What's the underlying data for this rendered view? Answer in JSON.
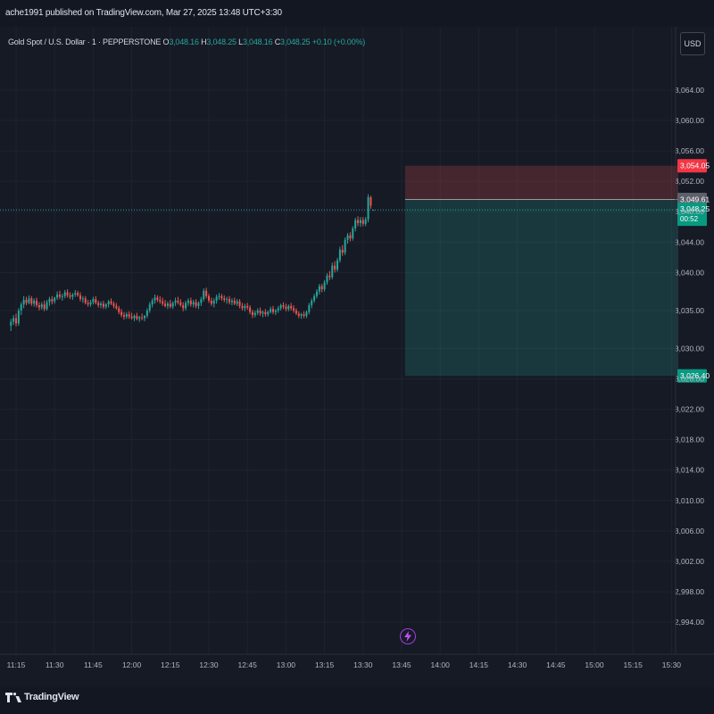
{
  "header": {
    "publisher_line": "ache1991 published on TradingView.com, Mar 27, 2025 13:48 UTC+3:30"
  },
  "legend": {
    "symbol": "Gold Spot / U.S. Dollar · 1 · PEPPERSTONE",
    "o_label": "O",
    "o_value": "3,048.16",
    "h_label": "H",
    "h_value": "3,048.25",
    "l_label": "L",
    "l_value": "3,048.16",
    "c_label": "C",
    "c_value": "3,048.25",
    "change": "+0.10 (+0.00%)"
  },
  "currency_button": "USD",
  "footer": {
    "logo_text": "TradingView",
    "logo_icon": "tradingview-logo-icon"
  },
  "flash_icon": "lightning-icon",
  "colors": {
    "up": "#26a69a",
    "down": "#ef5350",
    "stop_zone": "#ef5350",
    "target_zone": "#26a69a",
    "background": "#161a25"
  },
  "chart_data": {
    "type": "candlestick",
    "symbol": "Gold Spot / U.S. Dollar",
    "interval": "1",
    "y_ticks": [
      "3,064.00",
      "3,060.00",
      "3,056.00",
      "3,052.00",
      "3,048.00",
      "3,044.00",
      "3,040.00",
      "3,035.00",
      "3,030.00",
      "3,026.00",
      "3,022.00",
      "3,018.00",
      "3,014.00",
      "3,010.00",
      "3,006.00",
      "3,002.00",
      "2,998.00",
      "2,994.00"
    ],
    "y_tick_values": [
      3064,
      3060,
      3056,
      3052,
      3048,
      3044,
      3040,
      3035,
      3030,
      3026,
      3022,
      3018,
      3014,
      3010,
      3006,
      3002,
      2998,
      2994
    ],
    "x_ticks": [
      "11:15",
      "11:30",
      "11:45",
      "12:00",
      "12:15",
      "12:30",
      "12:45",
      "13:00",
      "13:15",
      "13:30",
      "13:45",
      "14:00",
      "14:15",
      "14:30",
      "14:45",
      "15:00",
      "15:15",
      "15:30"
    ],
    "price_labels": [
      {
        "text": "3,054.05",
        "value": 3054.05,
        "kind": "stop"
      },
      {
        "text": "3,049.61",
        "value": 3049.61,
        "kind": "entry"
      },
      {
        "text": "3,048.25",
        "sub": "00:52",
        "value": 3048.25,
        "kind": "last"
      },
      {
        "text": "3,026.40",
        "value": 3026.4,
        "kind": "target"
      }
    ],
    "position": {
      "entry": 3049.61,
      "stop": 3054.05,
      "target": 3026.4,
      "start_time": "13:46"
    },
    "last_price": 3048.25,
    "candles": [
      {
        "t": "11:13",
        "o": 3033.0,
        "h": 3033.9,
        "l": 3032.3,
        "c": 3033.5
      },
      {
        "t": "11:14",
        "o": 3033.5,
        "h": 3034.4,
        "l": 3033.1,
        "c": 3034.0
      },
      {
        "t": "11:15",
        "o": 3034.0,
        "h": 3034.6,
        "l": 3032.9,
        "c": 3033.3
      },
      {
        "t": "11:16",
        "o": 3033.3,
        "h": 3035.3,
        "l": 3033.0,
        "c": 3035.0
      },
      {
        "t": "11:17",
        "o": 3035.0,
        "h": 3036.1,
        "l": 3034.4,
        "c": 3035.8
      },
      {
        "t": "11:18",
        "o": 3035.8,
        "h": 3036.9,
        "l": 3035.3,
        "c": 3036.4
      },
      {
        "t": "11:19",
        "o": 3036.4,
        "h": 3036.8,
        "l": 3035.7,
        "c": 3036.0
      },
      {
        "t": "11:20",
        "o": 3036.0,
        "h": 3037.0,
        "l": 3035.8,
        "c": 3036.6
      },
      {
        "t": "11:21",
        "o": 3036.6,
        "h": 3036.9,
        "l": 3035.6,
        "c": 3035.9
      },
      {
        "t": "11:22",
        "o": 3035.9,
        "h": 3036.6,
        "l": 3035.5,
        "c": 3036.3
      },
      {
        "t": "11:23",
        "o": 3036.3,
        "h": 3036.7,
        "l": 3035.4,
        "c": 3035.7
      },
      {
        "t": "11:24",
        "o": 3035.7,
        "h": 3036.1,
        "l": 3035.0,
        "c": 3035.4
      },
      {
        "t": "11:25",
        "o": 3035.4,
        "h": 3036.1,
        "l": 3035.1,
        "c": 3035.8
      },
      {
        "t": "11:26",
        "o": 3035.8,
        "h": 3036.3,
        "l": 3034.9,
        "c": 3035.2
      },
      {
        "t": "11:27",
        "o": 3035.2,
        "h": 3036.4,
        "l": 3035.0,
        "c": 3036.1
      },
      {
        "t": "11:28",
        "o": 3036.1,
        "h": 3036.8,
        "l": 3035.6,
        "c": 3036.5
      },
      {
        "t": "11:29",
        "o": 3036.5,
        "h": 3036.9,
        "l": 3035.8,
        "c": 3036.2
      },
      {
        "t": "11:30",
        "o": 3036.2,
        "h": 3036.8,
        "l": 3035.9,
        "c": 3036.7
      },
      {
        "t": "11:31",
        "o": 3036.7,
        "h": 3037.5,
        "l": 3036.4,
        "c": 3037.1
      },
      {
        "t": "11:32",
        "o": 3037.1,
        "h": 3037.6,
        "l": 3036.5,
        "c": 3036.8
      },
      {
        "t": "11:33",
        "o": 3036.8,
        "h": 3037.2,
        "l": 3036.3,
        "c": 3036.9
      },
      {
        "t": "11:34",
        "o": 3036.9,
        "h": 3037.7,
        "l": 3036.6,
        "c": 3037.4
      },
      {
        "t": "11:35",
        "o": 3037.4,
        "h": 3037.8,
        "l": 3036.7,
        "c": 3037.0
      },
      {
        "t": "11:36",
        "o": 3037.0,
        "h": 3037.4,
        "l": 3036.5,
        "c": 3036.8
      },
      {
        "t": "11:37",
        "o": 3036.8,
        "h": 3037.3,
        "l": 3036.4,
        "c": 3037.1
      },
      {
        "t": "11:38",
        "o": 3037.1,
        "h": 3037.7,
        "l": 3036.8,
        "c": 3037.3
      },
      {
        "t": "11:39",
        "o": 3037.3,
        "h": 3037.6,
        "l": 3036.8,
        "c": 3037.0
      },
      {
        "t": "11:40",
        "o": 3037.0,
        "h": 3037.4,
        "l": 3036.2,
        "c": 3036.5
      },
      {
        "t": "11:41",
        "o": 3036.5,
        "h": 3036.9,
        "l": 3036.0,
        "c": 3036.6
      },
      {
        "t": "11:42",
        "o": 3036.6,
        "h": 3036.9,
        "l": 3035.8,
        "c": 3036.0
      },
      {
        "t": "11:43",
        "o": 3036.0,
        "h": 3036.4,
        "l": 3035.5,
        "c": 3035.8
      },
      {
        "t": "11:44",
        "o": 3035.8,
        "h": 3036.4,
        "l": 3035.5,
        "c": 3036.1
      },
      {
        "t": "11:45",
        "o": 3036.1,
        "h": 3036.8,
        "l": 3035.8,
        "c": 3036.5
      },
      {
        "t": "11:46",
        "o": 3036.5,
        "h": 3036.9,
        "l": 3035.8,
        "c": 3036.0
      },
      {
        "t": "11:47",
        "o": 3036.0,
        "h": 3036.3,
        "l": 3035.4,
        "c": 3035.7
      },
      {
        "t": "11:48",
        "o": 3035.7,
        "h": 3036.2,
        "l": 3035.3,
        "c": 3035.9
      },
      {
        "t": "11:49",
        "o": 3035.9,
        "h": 3036.3,
        "l": 3035.2,
        "c": 3035.5
      },
      {
        "t": "11:50",
        "o": 3035.5,
        "h": 3036.0,
        "l": 3035.2,
        "c": 3035.8
      },
      {
        "t": "11:51",
        "o": 3035.8,
        "h": 3036.4,
        "l": 3035.4,
        "c": 3036.2
      },
      {
        "t": "11:52",
        "o": 3036.2,
        "h": 3036.6,
        "l": 3035.7,
        "c": 3035.9
      },
      {
        "t": "11:53",
        "o": 3035.9,
        "h": 3036.2,
        "l": 3035.3,
        "c": 3035.6
      },
      {
        "t": "11:54",
        "o": 3035.6,
        "h": 3036.0,
        "l": 3035.1,
        "c": 3035.3
      },
      {
        "t": "11:55",
        "o": 3035.3,
        "h": 3035.6,
        "l": 3034.5,
        "c": 3034.8
      },
      {
        "t": "11:56",
        "o": 3034.8,
        "h": 3035.2,
        "l": 3034.1,
        "c": 3034.4
      },
      {
        "t": "11:57",
        "o": 3034.4,
        "h": 3034.8,
        "l": 3033.8,
        "c": 3034.2
      },
      {
        "t": "11:58",
        "o": 3034.2,
        "h": 3034.8,
        "l": 3033.9,
        "c": 3034.5
      },
      {
        "t": "11:59",
        "o": 3034.5,
        "h": 3034.9,
        "l": 3033.9,
        "c": 3034.2
      },
      {
        "t": "12:00",
        "o": 3034.2,
        "h": 3034.7,
        "l": 3033.8,
        "c": 3034.0
      },
      {
        "t": "12:01",
        "o": 3034.0,
        "h": 3034.5,
        "l": 3033.6,
        "c": 3034.3
      },
      {
        "t": "12:02",
        "o": 3034.3,
        "h": 3034.7,
        "l": 3033.7,
        "c": 3033.9
      },
      {
        "t": "12:03",
        "o": 3033.9,
        "h": 3034.3,
        "l": 3033.5,
        "c": 3034.1
      },
      {
        "t": "12:04",
        "o": 3034.1,
        "h": 3034.6,
        "l": 3033.7,
        "c": 3034.0
      },
      {
        "t": "12:05",
        "o": 3034.0,
        "h": 3034.4,
        "l": 3033.6,
        "c": 3034.3
      },
      {
        "t": "12:06",
        "o": 3034.3,
        "h": 3035.3,
        "l": 3034.0,
        "c": 3035.0
      },
      {
        "t": "12:07",
        "o": 3035.0,
        "h": 3036.1,
        "l": 3034.7,
        "c": 3035.8
      },
      {
        "t": "12:08",
        "o": 3035.8,
        "h": 3036.6,
        "l": 3035.4,
        "c": 3036.3
      },
      {
        "t": "12:09",
        "o": 3036.3,
        "h": 3037.1,
        "l": 3035.9,
        "c": 3036.7
      },
      {
        "t": "12:10",
        "o": 3036.7,
        "h": 3037.0,
        "l": 3036.1,
        "c": 3036.4
      },
      {
        "t": "12:11",
        "o": 3036.4,
        "h": 3036.9,
        "l": 3035.9,
        "c": 3036.2
      },
      {
        "t": "12:12",
        "o": 3036.2,
        "h": 3036.7,
        "l": 3035.6,
        "c": 3035.9
      },
      {
        "t": "12:13",
        "o": 3035.9,
        "h": 3036.4,
        "l": 3035.4,
        "c": 3035.6
      },
      {
        "t": "12:14",
        "o": 3035.6,
        "h": 3036.2,
        "l": 3035.2,
        "c": 3035.9
      },
      {
        "t": "12:15",
        "o": 3035.9,
        "h": 3036.4,
        "l": 3035.3,
        "c": 3035.5
      },
      {
        "t": "12:16",
        "o": 3035.5,
        "h": 3036.2,
        "l": 3035.2,
        "c": 3036.0
      },
      {
        "t": "12:17",
        "o": 3036.0,
        "h": 3036.7,
        "l": 3035.6,
        "c": 3036.3
      },
      {
        "t": "12:18",
        "o": 3036.3,
        "h": 3036.8,
        "l": 3035.8,
        "c": 3036.1
      },
      {
        "t": "12:19",
        "o": 3036.1,
        "h": 3036.5,
        "l": 3035.5,
        "c": 3035.7
      },
      {
        "t": "12:20",
        "o": 3035.7,
        "h": 3036.1,
        "l": 3034.9,
        "c": 3035.3
      },
      {
        "t": "12:21",
        "o": 3035.3,
        "h": 3036.3,
        "l": 3035.0,
        "c": 3036.0
      },
      {
        "t": "12:22",
        "o": 3036.0,
        "h": 3036.6,
        "l": 3035.6,
        "c": 3036.3
      },
      {
        "t": "12:23",
        "o": 3036.3,
        "h": 3036.7,
        "l": 3035.5,
        "c": 3035.8
      },
      {
        "t": "12:24",
        "o": 3035.8,
        "h": 3036.4,
        "l": 3035.4,
        "c": 3036.1
      },
      {
        "t": "12:25",
        "o": 3036.1,
        "h": 3036.5,
        "l": 3035.3,
        "c": 3035.6
      },
      {
        "t": "12:26",
        "o": 3035.6,
        "h": 3036.2,
        "l": 3035.2,
        "c": 3036.0
      },
      {
        "t": "12:27",
        "o": 3036.0,
        "h": 3036.8,
        "l": 3035.6,
        "c": 3036.5
      },
      {
        "t": "12:28",
        "o": 3036.5,
        "h": 3037.9,
        "l": 3036.2,
        "c": 3037.6
      },
      {
        "t": "12:29",
        "o": 3037.6,
        "h": 3038.0,
        "l": 3036.6,
        "c": 3036.9
      },
      {
        "t": "12:30",
        "o": 3036.9,
        "h": 3037.2,
        "l": 3036.0,
        "c": 3036.3
      },
      {
        "t": "12:31",
        "o": 3036.3,
        "h": 3036.7,
        "l": 3035.6,
        "c": 3035.9
      },
      {
        "t": "12:32",
        "o": 3035.9,
        "h": 3036.6,
        "l": 3035.4,
        "c": 3036.3
      },
      {
        "t": "12:33",
        "o": 3036.3,
        "h": 3037.1,
        "l": 3035.9,
        "c": 3036.8
      },
      {
        "t": "12:34",
        "o": 3036.8,
        "h": 3037.3,
        "l": 3036.4,
        "c": 3036.9
      },
      {
        "t": "12:35",
        "o": 3036.9,
        "h": 3037.2,
        "l": 3036.3,
        "c": 3036.6
      },
      {
        "t": "12:36",
        "o": 3036.6,
        "h": 3037.0,
        "l": 3036.1,
        "c": 3036.4
      },
      {
        "t": "12:37",
        "o": 3036.4,
        "h": 3036.8,
        "l": 3035.9,
        "c": 3036.5
      },
      {
        "t": "12:38",
        "o": 3036.5,
        "h": 3036.9,
        "l": 3035.8,
        "c": 3036.1
      },
      {
        "t": "12:39",
        "o": 3036.1,
        "h": 3036.6,
        "l": 3035.7,
        "c": 3036.3
      },
      {
        "t": "12:40",
        "o": 3036.3,
        "h": 3036.7,
        "l": 3035.7,
        "c": 3035.9
      },
      {
        "t": "12:41",
        "o": 3035.9,
        "h": 3036.5,
        "l": 3035.6,
        "c": 3036.2
      },
      {
        "t": "12:42",
        "o": 3036.2,
        "h": 3036.5,
        "l": 3035.3,
        "c": 3035.6
      },
      {
        "t": "12:43",
        "o": 3035.6,
        "h": 3036.0,
        "l": 3035.0,
        "c": 3035.3
      },
      {
        "t": "12:44",
        "o": 3035.3,
        "h": 3035.9,
        "l": 3034.9,
        "c": 3035.6
      },
      {
        "t": "12:45",
        "o": 3035.6,
        "h": 3036.0,
        "l": 3035.1,
        "c": 3035.4
      },
      {
        "t": "12:46",
        "o": 3035.4,
        "h": 3035.7,
        "l": 3034.5,
        "c": 3034.8
      },
      {
        "t": "12:47",
        "o": 3034.8,
        "h": 3035.1,
        "l": 3034.0,
        "c": 3034.4
      },
      {
        "t": "12:48",
        "o": 3034.4,
        "h": 3035.0,
        "l": 3034.1,
        "c": 3034.7
      },
      {
        "t": "12:49",
        "o": 3034.7,
        "h": 3035.3,
        "l": 3034.4,
        "c": 3035.0
      },
      {
        "t": "12:50",
        "o": 3035.0,
        "h": 3035.4,
        "l": 3034.3,
        "c": 3034.6
      },
      {
        "t": "12:51",
        "o": 3034.6,
        "h": 3035.0,
        "l": 3034.1,
        "c": 3034.8
      },
      {
        "t": "12:52",
        "o": 3034.8,
        "h": 3035.2,
        "l": 3034.2,
        "c": 3034.5
      },
      {
        "t": "12:53",
        "o": 3034.5,
        "h": 3035.0,
        "l": 3034.2,
        "c": 3034.8
      },
      {
        "t": "12:54",
        "o": 3034.8,
        "h": 3035.5,
        "l": 3034.6,
        "c": 3035.2
      },
      {
        "t": "12:55",
        "o": 3035.2,
        "h": 3035.6,
        "l": 3034.5,
        "c": 3034.8
      },
      {
        "t": "12:56",
        "o": 3034.8,
        "h": 3035.2,
        "l": 3034.4,
        "c": 3035.0
      },
      {
        "t": "12:57",
        "o": 3035.0,
        "h": 3035.6,
        "l": 3034.7,
        "c": 3035.3
      },
      {
        "t": "12:58",
        "o": 3035.3,
        "h": 3035.9,
        "l": 3035.0,
        "c": 3035.7
      },
      {
        "t": "12:59",
        "o": 3035.7,
        "h": 3036.1,
        "l": 3035.2,
        "c": 3035.5
      },
      {
        "t": "13:00",
        "o": 3035.5,
        "h": 3035.9,
        "l": 3034.9,
        "c": 3035.2
      },
      {
        "t": "13:01",
        "o": 3035.2,
        "h": 3035.8,
        "l": 3034.9,
        "c": 3035.6
      },
      {
        "t": "13:02",
        "o": 3035.6,
        "h": 3036.0,
        "l": 3035.0,
        "c": 3035.3
      },
      {
        "t": "13:03",
        "o": 3035.3,
        "h": 3035.7,
        "l": 3034.7,
        "c": 3035.0
      },
      {
        "t": "13:04",
        "o": 3035.0,
        "h": 3035.3,
        "l": 3034.4,
        "c": 3034.6
      },
      {
        "t": "13:05",
        "o": 3034.6,
        "h": 3034.9,
        "l": 3034.0,
        "c": 3034.3
      },
      {
        "t": "13:06",
        "o": 3034.3,
        "h": 3034.7,
        "l": 3033.9,
        "c": 3034.5
      },
      {
        "t": "13:07",
        "o": 3034.5,
        "h": 3034.9,
        "l": 3034.0,
        "c": 3034.3
      },
      {
        "t": "13:08",
        "o": 3034.3,
        "h": 3035.0,
        "l": 3034.0,
        "c": 3034.8
      },
      {
        "t": "13:09",
        "o": 3034.8,
        "h": 3036.0,
        "l": 3034.5,
        "c": 3035.7
      },
      {
        "t": "13:10",
        "o": 3035.7,
        "h": 3036.6,
        "l": 3035.3,
        "c": 3036.3
      },
      {
        "t": "13:11",
        "o": 3036.3,
        "h": 3037.2,
        "l": 3036.0,
        "c": 3036.9
      },
      {
        "t": "13:12",
        "o": 3036.9,
        "h": 3037.8,
        "l": 3036.6,
        "c": 3037.5
      },
      {
        "t": "13:13",
        "o": 3037.5,
        "h": 3038.5,
        "l": 3037.1,
        "c": 3038.2
      },
      {
        "t": "13:14",
        "o": 3038.2,
        "h": 3038.5,
        "l": 3037.4,
        "c": 3037.8
      },
      {
        "t": "13:15",
        "o": 3037.8,
        "h": 3039.0,
        "l": 3037.5,
        "c": 3038.7
      },
      {
        "t": "13:16",
        "o": 3038.7,
        "h": 3039.9,
        "l": 3038.4,
        "c": 3039.6
      },
      {
        "t": "13:17",
        "o": 3039.6,
        "h": 3040.2,
        "l": 3039.0,
        "c": 3039.4
      },
      {
        "t": "13:18",
        "o": 3039.4,
        "h": 3041.3,
        "l": 3039.1,
        "c": 3040.9
      },
      {
        "t": "13:19",
        "o": 3040.9,
        "h": 3041.5,
        "l": 3040.0,
        "c": 3040.4
      },
      {
        "t": "13:20",
        "o": 3040.4,
        "h": 3041.9,
        "l": 3040.1,
        "c": 3041.6
      },
      {
        "t": "13:21",
        "o": 3041.6,
        "h": 3043.4,
        "l": 3041.3,
        "c": 3043.0
      },
      {
        "t": "13:22",
        "o": 3043.0,
        "h": 3043.6,
        "l": 3042.2,
        "c": 3042.6
      },
      {
        "t": "13:23",
        "o": 3042.6,
        "h": 3044.6,
        "l": 3042.3,
        "c": 3044.3
      },
      {
        "t": "13:24",
        "o": 3044.3,
        "h": 3045.2,
        "l": 3043.8,
        "c": 3044.9
      },
      {
        "t": "13:25",
        "o": 3044.9,
        "h": 3045.3,
        "l": 3044.1,
        "c": 3044.5
      },
      {
        "t": "13:26",
        "o": 3044.5,
        "h": 3046.1,
        "l": 3044.2,
        "c": 3045.8
      },
      {
        "t": "13:27",
        "o": 3045.8,
        "h": 3047.2,
        "l": 3045.4,
        "c": 3046.9
      },
      {
        "t": "13:28",
        "o": 3046.9,
        "h": 3047.4,
        "l": 3046.1,
        "c": 3046.5
      },
      {
        "t": "13:29",
        "o": 3046.5,
        "h": 3047.3,
        "l": 3046.0,
        "c": 3046.9
      },
      {
        "t": "13:30",
        "o": 3046.9,
        "h": 3047.3,
        "l": 3046.1,
        "c": 3046.4
      },
      {
        "t": "13:31",
        "o": 3046.4,
        "h": 3047.3,
        "l": 3046.1,
        "c": 3047.0
      },
      {
        "t": "13:32",
        "o": 3047.0,
        "h": 3050.3,
        "l": 3046.6,
        "c": 3049.9
      },
      {
        "t": "13:33",
        "o": 3049.9,
        "h": 3050.1,
        "l": 3048.4,
        "c": 3048.8
      },
      {
        "t": "13:34",
        "o": 3048.16,
        "h": 3048.25,
        "l": 3048.16,
        "c": 3048.25
      }
    ]
  }
}
